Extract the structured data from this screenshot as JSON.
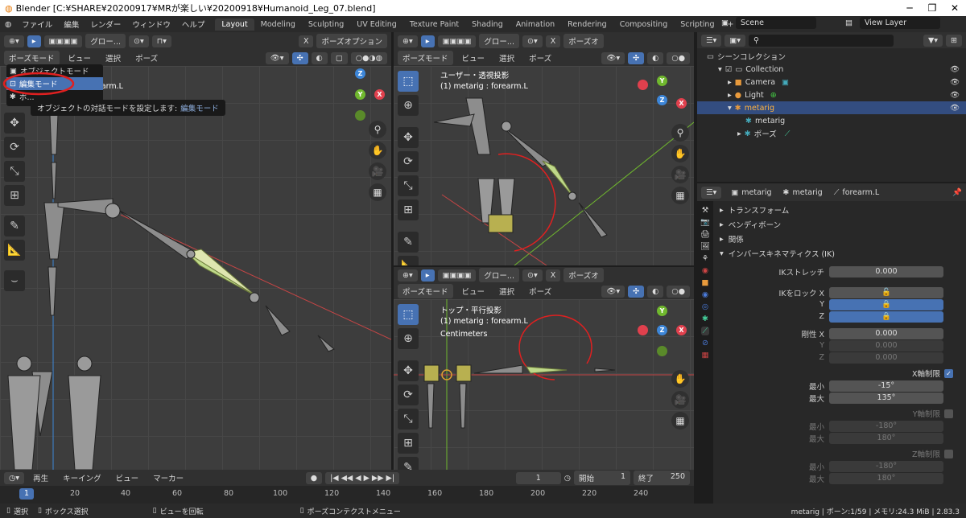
{
  "window": {
    "title": "Blender [C:¥SHARE¥20200917¥MRが楽しい¥20200918¥Humanoid_Leg_07.blend]",
    "minimize": "─",
    "maximize": "❐",
    "close": "✕"
  },
  "menu": [
    "ファイル",
    "編集",
    "レンダー",
    "ウィンドウ",
    "ヘルプ"
  ],
  "workspaces": [
    "Layout",
    "Modeling",
    "Sculpting",
    "UV Editing",
    "Texture Paint",
    "Shading",
    "Animation",
    "Rendering",
    "Compositing",
    "Scripting",
    "+"
  ],
  "scene": {
    "label": "Scene",
    "view_layer": "View Layer"
  },
  "viewport_left": {
    "orientation": "グロー...",
    "pose_options": "ポーズオプション",
    "mode": "ポーズモード",
    "menus": [
      "ビュー",
      "選択",
      "ポーズ"
    ],
    "overlay_text_1": "影",
    "overlay_text_2": "earm.L",
    "dropdown": {
      "items": [
        "オブジェクトモード",
        "編集モード",
        "ポ..."
      ]
    },
    "tooltip": {
      "text": "オブジェクトの対話モードを設定します:",
      "value": "編集モード"
    }
  },
  "viewport_tr": {
    "orientation": "グロー...",
    "pose_options": "ポーズオ",
    "mode": "ポーズモード",
    "menus": [
      "ビュー",
      "選択",
      "ポーズ"
    ],
    "view_name": "ユーザー・透視投影",
    "object_info": "(1) metarig : forearm.L"
  },
  "viewport_br": {
    "orientation": "グロー...",
    "pose_options": "ポーズオ",
    "mode": "ポーズモード",
    "menus": [
      "ビュー",
      "選択",
      "ポーズ"
    ],
    "view_name": "トップ・平行投影",
    "object_info": "(1) metarig : forearm.L",
    "units": "Centimeters"
  },
  "gizmo": {
    "x": "X",
    "y": "Y",
    "z": "Z"
  },
  "outliner": {
    "search_placeholder": "",
    "scene_collection": "シーンコレクション",
    "items": [
      {
        "label": "Collection",
        "indent": 1
      },
      {
        "label": "Camera",
        "indent": 2
      },
      {
        "label": "Light",
        "indent": 2
      },
      {
        "label": "metarig",
        "indent": 2
      },
      {
        "label": "metarig",
        "indent": 3
      },
      {
        "label": "ポーズ",
        "indent": 3
      }
    ]
  },
  "properties": {
    "breadcrumb": [
      "metarig",
      "metarig",
      "forearm.L"
    ],
    "panels": [
      "トランスフォーム",
      "ベンディボーン",
      "関係",
      "インバースキネマティクス (IK)"
    ],
    "ik": {
      "stretch_label": "IKストレッチ",
      "stretch_value": "0.000",
      "lock_label": "IKをロック X",
      "lock_y": "Y",
      "lock_z": "Z",
      "stiff_label": "剛性 X",
      "stiff_x": "0.000",
      "stiff_y_label": "Y",
      "stiff_y": "0.000",
      "stiff_z_label": "Z",
      "stiff_z": "0.000",
      "xlimit_label": "X軸制限",
      "xmin_label": "最小",
      "xmin": "-15°",
      "xmax_label": "最大",
      "xmax": "135°",
      "ylimit_label": "Y軸制限",
      "ymin_label": "最小",
      "ymin": "-180°",
      "ymax_label": "最大",
      "ymax": "180°",
      "zlimit_label": "Z軸制限",
      "zmin_label": "最小",
      "zmin": "-180°",
      "zmax_label": "最大",
      "zmax": "180°"
    }
  },
  "timeline": {
    "menus": [
      "再生",
      "キーイング",
      "ビュー",
      "マーカー"
    ],
    "current_frame": "1",
    "start_label": "開始",
    "start": "1",
    "end_label": "終了",
    "end": "250",
    "ticks": [
      "1",
      "20",
      "40",
      "60",
      "80",
      "100",
      "120",
      "140",
      "160",
      "180",
      "200",
      "220",
      "240"
    ]
  },
  "status": {
    "select": "選択",
    "box_select": "ボックス選択",
    "rotate_view": "ビューを回転",
    "context_menu": "ポーズコンテクストメニュー",
    "info": "metarig | ボーン:1/59 | メモリ:24.3 MiB | 2.83.3"
  },
  "colors": {
    "accent": "#4772b3",
    "bone_active": "#bfd98a",
    "x_axis": "#e0404d",
    "y_axis": "#70b82e",
    "z_axis": "#3d86d8",
    "annotation": "#e02020"
  }
}
